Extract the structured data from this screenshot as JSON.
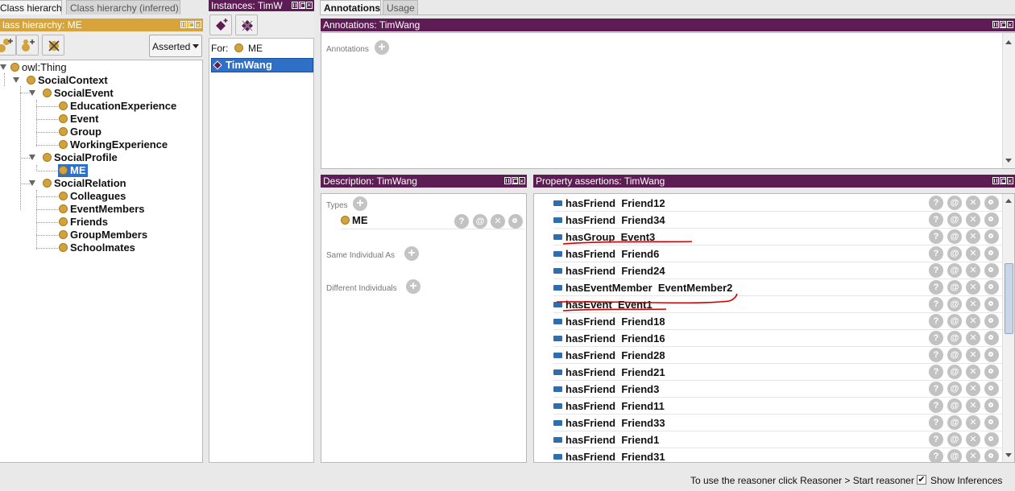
{
  "tabs_left": [
    "Class hierarchy",
    "Class hierarchy (inferred)"
  ],
  "tab_instances": "Instances: TimW",
  "tabs_right": [
    "Annotations",
    "Usage"
  ],
  "class_hierarchy": {
    "title": "lass hierarchy: ME",
    "asserted_label": "Asserted",
    "tree": {
      "root": "owl:Thing",
      "social_context": "SocialContext",
      "social_event": "SocialEvent",
      "education": "EducationExperience",
      "event": "Event",
      "group": "Group",
      "working": "WorkingExperience",
      "social_profile": "SocialProfile",
      "me": "ME",
      "social_relation": "SocialRelation",
      "colleagues": "Colleagues",
      "event_members": "EventMembers",
      "friends": "Friends",
      "group_members": "GroupMembers",
      "schoolmates": "Schoolmates"
    }
  },
  "instances": {
    "for_label": "For:",
    "for_value": "ME",
    "selected": "TimWang"
  },
  "annotations": {
    "title": "Annotations: TimWang",
    "label": "Annotations"
  },
  "description": {
    "title": "Description: TimWang",
    "types_label": "Types",
    "type_value": "ME",
    "same_label": "Same Individual As",
    "different_label": "Different Individuals"
  },
  "property_assertions": {
    "title": "Property assertions: TimWang",
    "rows": [
      {
        "prop": "hasFriend",
        "value": "Friend12"
      },
      {
        "prop": "hasFriend",
        "value": "Friend34"
      },
      {
        "prop": "hasGroup",
        "value": "Event3"
      },
      {
        "prop": "hasFriend",
        "value": "Friend6"
      },
      {
        "prop": "hasFriend",
        "value": "Friend24"
      },
      {
        "prop": "hasEventMember",
        "value": "EventMember2"
      },
      {
        "prop": "hasEvent",
        "value": "Event1"
      },
      {
        "prop": "hasFriend",
        "value": "Friend18"
      },
      {
        "prop": "hasFriend",
        "value": "Friend16"
      },
      {
        "prop": "hasFriend",
        "value": "Friend28"
      },
      {
        "prop": "hasFriend",
        "value": "Friend21"
      },
      {
        "prop": "hasFriend",
        "value": "Friend3"
      },
      {
        "prop": "hasFriend",
        "value": "Friend11"
      },
      {
        "prop": "hasFriend",
        "value": "Friend33"
      },
      {
        "prop": "hasFriend",
        "value": "Friend1"
      },
      {
        "prop": "hasFriend",
        "value": "Friend31"
      }
    ]
  },
  "status": {
    "reasoner_hint": "To use the reasoner click Reasoner > Start reasoner",
    "show_inferences": "Show Inferences"
  },
  "colors": {
    "view_bar": "#5e1c54",
    "hierarchy_bar": "#d7a43c",
    "selection": "#2e6fc7",
    "class_dot": "#d2a33c",
    "annotation_ink": "#d40000"
  }
}
